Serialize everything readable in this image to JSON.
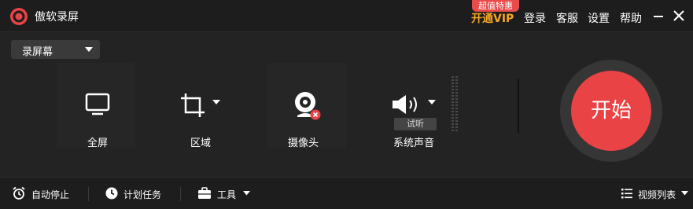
{
  "colors": {
    "accent_red": "#e94345",
    "vip_gold": "#f5a623",
    "background": "#232323"
  },
  "titlebar": {
    "app_title": "傲软录屏",
    "promo_badge": "超值特惠",
    "vip_label": "开通VIP",
    "login_label": "登录",
    "support_label": "客服",
    "settings_label": "设置",
    "help_label": "帮助",
    "icons": {
      "logo": "record-logo-icon",
      "minimize": "minimize-icon",
      "close": "close-icon"
    }
  },
  "mode_select": {
    "value": "录屏幕",
    "icon": "chevron-down-icon"
  },
  "tools": {
    "fullscreen": {
      "label": "全屏",
      "icon": "monitor-icon"
    },
    "region": {
      "label": "区域",
      "icon": "crop-icon"
    },
    "webcam": {
      "label": "摄像头",
      "icon": "webcam-icon",
      "status_icon": "disabled-x-icon"
    },
    "audio": {
      "label": "系统声音",
      "icon": "speaker-icon",
      "trial_label": "试听"
    }
  },
  "start_button": {
    "label": "开始"
  },
  "bottombar": {
    "auto_stop_label": "自动停止",
    "schedule_label": "计划任务",
    "tools_label": "工具",
    "video_list_label": "视频列表",
    "icons": {
      "auto_stop": "alarm-clock-icon",
      "schedule": "clock-icon",
      "tools": "toolbox-icon",
      "video_list": "list-icon"
    }
  }
}
